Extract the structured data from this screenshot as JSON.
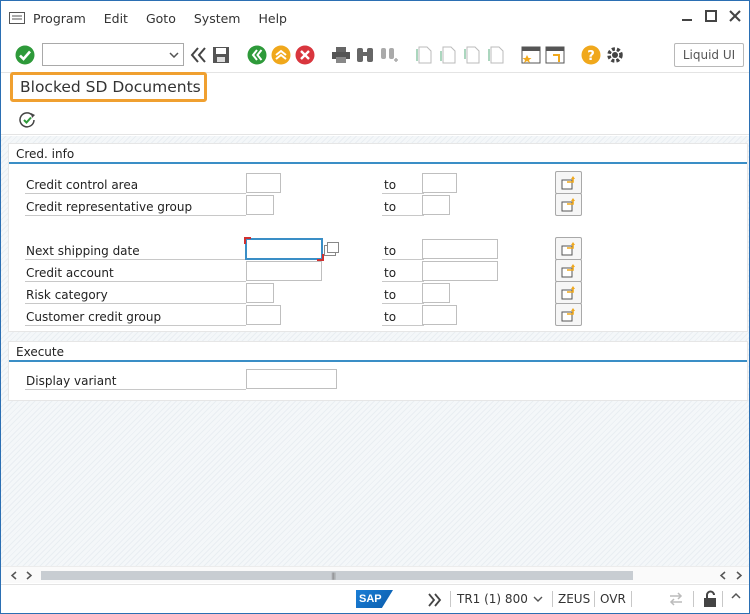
{
  "menu": {
    "items": [
      {
        "label": "Program"
      },
      {
        "label": "Edit"
      },
      {
        "label": "Goto"
      },
      {
        "label": "System"
      },
      {
        "label": "Help"
      }
    ]
  },
  "toolbar": {
    "command_field_value": "",
    "liquid_ui_label": "Liquid UI",
    "icons": [
      "enter-icon",
      "back-double-icon",
      "save-icon",
      "back-icon",
      "exit-icon",
      "cancel-icon",
      "print-icon",
      "find-icon",
      "find-next-icon",
      "first-page-icon",
      "prev-page-icon",
      "next-page-icon",
      "last-page-icon",
      "new-session-icon",
      "shortcut-icon",
      "help-icon",
      "settings-icon"
    ]
  },
  "title": "Blocked SD Documents",
  "execute_icon": "execute-icon",
  "groups": {
    "cred_info": {
      "title": "Cred. info",
      "rows": [
        {
          "label": "Credit control area",
          "from": "",
          "to_label": "to",
          "to": ""
        },
        {
          "label": "Credit representative group",
          "from": "",
          "to_label": "to",
          "to": ""
        },
        {
          "label": "Next shipping date",
          "from": "",
          "to_label": "to",
          "to": ""
        },
        {
          "label": "Credit account",
          "from": "",
          "to_label": "to",
          "to": ""
        },
        {
          "label": "Risk category",
          "from": "",
          "to_label": "to",
          "to": ""
        },
        {
          "label": "Customer credit group",
          "from": "",
          "to_label": "to",
          "to": ""
        }
      ]
    },
    "execute": {
      "title": "Execute",
      "rows": [
        {
          "label": "Display variant",
          "value": ""
        }
      ]
    }
  },
  "statusbar": {
    "sap_logo": "SAP",
    "system": "TR1 (1) 800",
    "server": "ZEUS",
    "mode": "OVR"
  },
  "colors": {
    "accent_blue": "#3a8ec6",
    "title_highlight": "#f0a030",
    "enter_green": "#2e9a3a",
    "cancel_red": "#d9363e",
    "help_orange": "#f0a81c"
  }
}
